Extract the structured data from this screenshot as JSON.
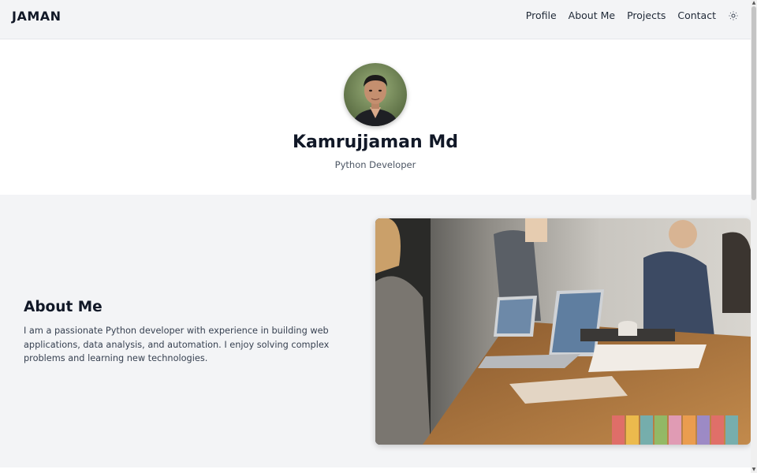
{
  "navbar": {
    "brand": "JAMAN",
    "links": [
      "Profile",
      "About Me",
      "Projects",
      "Contact"
    ],
    "theme_icon": "sun-icon"
  },
  "hero": {
    "name": "Kamrujjaman Md",
    "role": "Python Developer"
  },
  "about": {
    "title": "About Me",
    "text": "I am a passionate Python developer with experience in building web applications, data analysis, and automation. I enjoy solving complex problems and learning new technologies."
  }
}
